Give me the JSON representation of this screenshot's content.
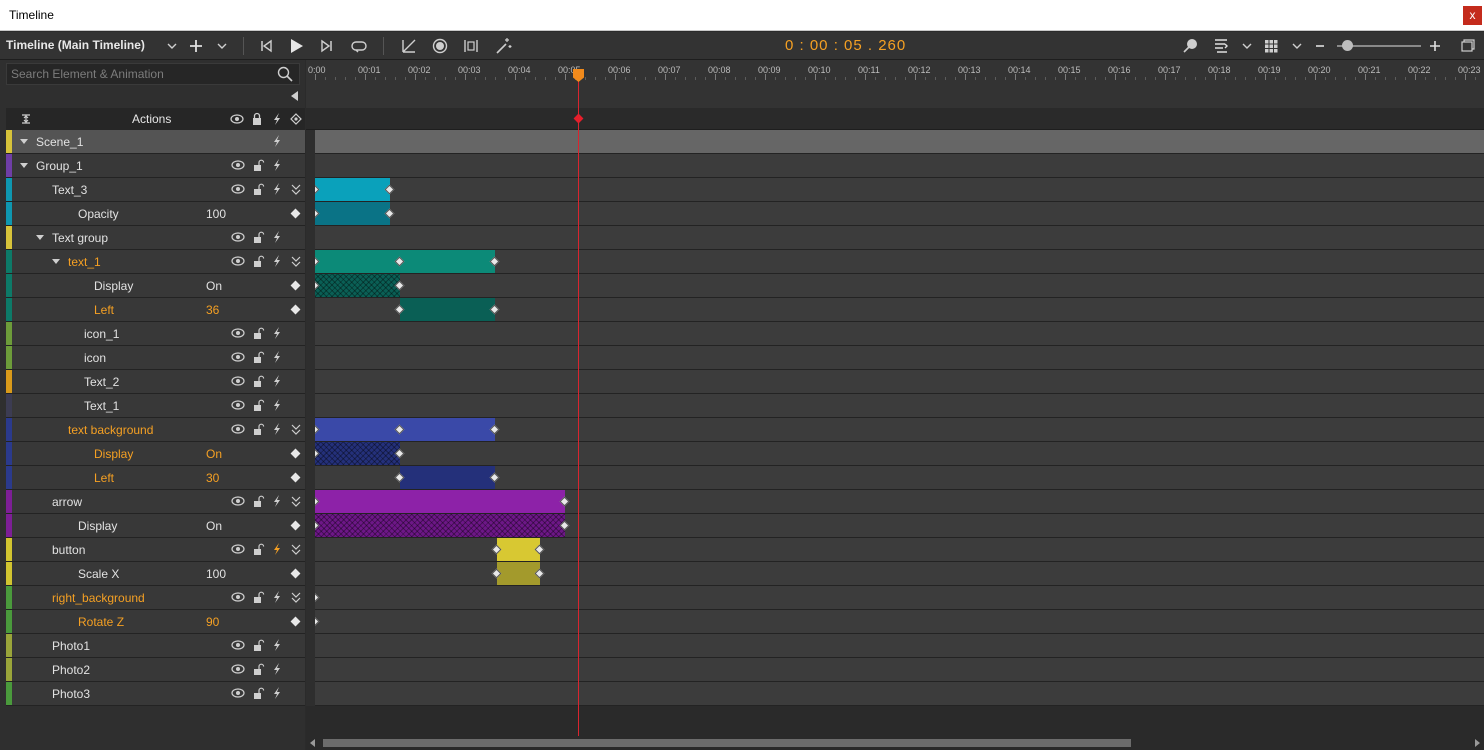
{
  "window": {
    "title": "Timeline",
    "close_glyph": "x"
  },
  "toolbar": {
    "timeline_name": "Timeline (Main Timeline)",
    "time": "0 : 00 : 05 . 260",
    "icons": [
      "chevron-down-icon",
      "add-icon",
      "chevron-down-icon",
      "skip-start-icon",
      "play-icon",
      "next-frame-icon",
      "loop-icon",
      "easing-icon",
      "record-icon",
      "distribute-icon",
      "magic-icon",
      "pin-icon",
      "snap-icon",
      "chevron-down-icon",
      "grid-icon",
      "chevron-down-icon",
      "zoom-out-icon",
      "zoom-in-icon",
      "popout-icon"
    ],
    "zoom_level": 0.08
  },
  "search": {
    "placeholder": "Search Element & Animation"
  },
  "actions_header": {
    "label": "Actions"
  },
  "ruler": {
    "labels": [
      "0:00",
      "00:01",
      "00:02",
      "00:03",
      "00:04",
      "00:05",
      "00:06",
      "00:07",
      "00:08",
      "00:09",
      "00:10",
      "00:11",
      "00:12",
      "00:13",
      "00:14",
      "00:15",
      "00:16",
      "00:17",
      "00:18",
      "00:19",
      "00:20",
      "00:21",
      "00:22",
      "00:23"
    ]
  },
  "colors": {
    "accent": "#f5a023",
    "playhead": "#d9252f"
  },
  "rows": [
    {
      "name": "Scene_1",
      "indent": 0,
      "kind": "scene",
      "strip": "#d7c33a",
      "arrow": true,
      "icons": [
        "lightning-icon"
      ]
    },
    {
      "name": "Group_1",
      "indent": 0,
      "kind": "layer",
      "strip": "#6f3ea6",
      "arrow": true,
      "icons": [
        "eye-icon",
        "lock-icon",
        "lightning-icon"
      ]
    },
    {
      "name": "Text_3",
      "indent": 1,
      "kind": "layer",
      "strip": "#0f97b0",
      "icons": [
        "eye-icon",
        "lock-icon",
        "lightning-icon",
        "expand-icon"
      ]
    },
    {
      "name": "Opacity",
      "indent": 2,
      "kind": "prop",
      "strip": "#0f97b0",
      "value": "100",
      "keyframe": true
    },
    {
      "name": "Text group",
      "indent": 1,
      "kind": "layer",
      "strip": "#d7c33a",
      "arrow": true,
      "icons": [
        "eye-icon",
        "lock-icon",
        "lightning-icon"
      ]
    },
    {
      "name": "text_1",
      "indent": 2,
      "kind": "layer",
      "strip": "#0d7a68",
      "arrow": true,
      "orange": true,
      "icons": [
        "eye-icon",
        "lock-icon",
        "lightning-icon",
        "expand-icon"
      ]
    },
    {
      "name": "Display",
      "indent": 3,
      "kind": "prop",
      "strip": "#0d7a68",
      "value": "On",
      "keyframe": true
    },
    {
      "name": "Left",
      "indent": 3,
      "kind": "prop",
      "strip": "#0d7a68",
      "value": "36",
      "orange": true,
      "keyframe": true
    },
    {
      "name": "icon_1",
      "indent": 3,
      "kind": "layer",
      "strip": "#6d9c3a",
      "icons": [
        "eye-icon",
        "lock-icon",
        "lightning-icon"
      ]
    },
    {
      "name": "icon",
      "indent": 3,
      "kind": "layer",
      "strip": "#6d9c3a",
      "icons": [
        "eye-icon",
        "lock-icon",
        "lightning-icon"
      ]
    },
    {
      "name": "Text_2",
      "indent": 3,
      "kind": "layer",
      "strip": "#d99a1a",
      "icons": [
        "eye-icon",
        "lock-icon",
        "lightning-icon"
      ]
    },
    {
      "name": "Text_1",
      "indent": 3,
      "kind": "layer",
      "strip": "#3c3c52",
      "icons": [
        "eye-icon",
        "lock-icon",
        "lightning-icon"
      ]
    },
    {
      "name": "text background",
      "indent": 2,
      "kind": "layer",
      "strip": "#2b3a8c",
      "orange": true,
      "icons": [
        "eye-icon",
        "lock-icon",
        "lightning-icon",
        "expand-icon"
      ]
    },
    {
      "name": "Display",
      "indent": 3,
      "kind": "prop",
      "strip": "#2b3a8c",
      "value": "On",
      "orange": true,
      "keyframe": true
    },
    {
      "name": "Left",
      "indent": 3,
      "kind": "prop",
      "strip": "#2b3a8c",
      "value": "30",
      "orange": true,
      "keyframe": true
    },
    {
      "name": "arrow",
      "indent": 1,
      "kind": "layer",
      "strip": "#7d1f96",
      "icons": [
        "eye-icon",
        "lock-icon",
        "lightning-icon",
        "expand-icon"
      ]
    },
    {
      "name": "Display",
      "indent": 2,
      "kind": "prop",
      "strip": "#7d1f96",
      "value": "On",
      "keyframe": true
    },
    {
      "name": "button",
      "indent": 1,
      "kind": "layer",
      "strip": "#d1c430",
      "icons": [
        "eye-icon",
        "lock-icon",
        "lightning-orange-icon",
        "expand-icon"
      ]
    },
    {
      "name": "Scale X",
      "indent": 2,
      "kind": "prop",
      "strip": "#d1c430",
      "value": "100",
      "keyframe": true
    },
    {
      "name": "right_background",
      "indent": 1,
      "kind": "layer",
      "strip": "#4a9a3c",
      "orange": true,
      "icons": [
        "eye-icon",
        "lock-icon",
        "lightning-icon",
        "expand-icon"
      ]
    },
    {
      "name": "Rotate Z",
      "indent": 2,
      "kind": "prop",
      "strip": "#4a9a3c",
      "value": "90",
      "orange": true,
      "keyframe": true
    },
    {
      "name": "Photo1",
      "indent": 1,
      "kind": "layer",
      "strip": "#9aa53a",
      "icons": [
        "eye-icon",
        "lock-icon",
        "lightning-icon"
      ]
    },
    {
      "name": "Photo2",
      "indent": 1,
      "kind": "layer",
      "strip": "#9aa53a",
      "icons": [
        "eye-icon",
        "lock-icon",
        "lightning-icon"
      ]
    },
    {
      "name": "Photo3",
      "indent": 1,
      "kind": "layer",
      "strip": "#4a9a3c",
      "icons": [
        "eye-icon",
        "lock-icon",
        "lightning-icon"
      ]
    }
  ],
  "tracks": [
    {
      "bars": []
    },
    {
      "bars": []
    },
    {
      "bars": [
        {
          "start": 0.0,
          "end": 1.5,
          "color": "#0aa1bb",
          "kfs": [
            0.0,
            1.5
          ]
        }
      ]
    },
    {
      "bars": [
        {
          "start": 0.0,
          "end": 1.5,
          "color": "#0a7386",
          "kfs": [
            0.0,
            1.5
          ]
        }
      ]
    },
    {
      "bars": []
    },
    {
      "bars": [
        {
          "start": 0.0,
          "end": 3.6,
          "color": "#0c8a78",
          "kfs": [
            0.0,
            1.7,
            3.6
          ]
        }
      ]
    },
    {
      "bars": [
        {
          "start": 0.0,
          "end": 1.7,
          "color": "#0a5f55",
          "hatch": true,
          "kfs": [
            0.0,
            1.7
          ]
        }
      ]
    },
    {
      "bars": [
        {
          "start": 1.7,
          "end": 3.6,
          "color": "#0a5f55",
          "kfs": [
            1.7,
            3.6
          ]
        }
      ]
    },
    {
      "bars": []
    },
    {
      "bars": []
    },
    {
      "bars": []
    },
    {
      "bars": []
    },
    {
      "bars": [
        {
          "start": 0.0,
          "end": 3.6,
          "color": "#3a49a8",
          "kfs": [
            0.0,
            1.7,
            3.6
          ]
        }
      ]
    },
    {
      "bars": [
        {
          "start": 0.0,
          "end": 1.7,
          "color": "#24307a",
          "hatch": true,
          "kfs": [
            0.0,
            1.7
          ]
        }
      ]
    },
    {
      "bars": [
        {
          "start": 1.7,
          "end": 3.6,
          "color": "#24307a",
          "kfs": [
            1.7,
            3.6
          ]
        }
      ]
    },
    {
      "bars": [
        {
          "start": 0.0,
          "end": 5.0,
          "color": "#8d22a8",
          "kfs": [
            0.0,
            5.0
          ]
        }
      ]
    },
    {
      "bars": [
        {
          "start": 0.0,
          "end": 5.0,
          "color": "#6d1787",
          "hatch": true,
          "kfs": [
            0.0,
            5.0
          ]
        }
      ]
    },
    {
      "bars": [
        {
          "start": 3.64,
          "end": 4.5,
          "color": "#d8c832",
          "kfs": [
            3.64,
            4.5
          ]
        }
      ]
    },
    {
      "bars": [
        {
          "start": 3.64,
          "end": 4.5,
          "color": "#a39a2c",
          "kfs": [
            3.64,
            4.5
          ]
        }
      ]
    },
    {
      "bars": [
        {
          "start": 0.0,
          "end": 0.0,
          "color": "transparent",
          "kfs": [
            0.0
          ]
        }
      ]
    },
    {
      "bars": [
        {
          "start": 0.0,
          "end": 0.0,
          "color": "transparent",
          "kfs": [
            0.0
          ]
        }
      ]
    },
    {
      "bars": []
    },
    {
      "bars": []
    },
    {
      "bars": []
    }
  ],
  "playhead_seconds": 5.26
}
